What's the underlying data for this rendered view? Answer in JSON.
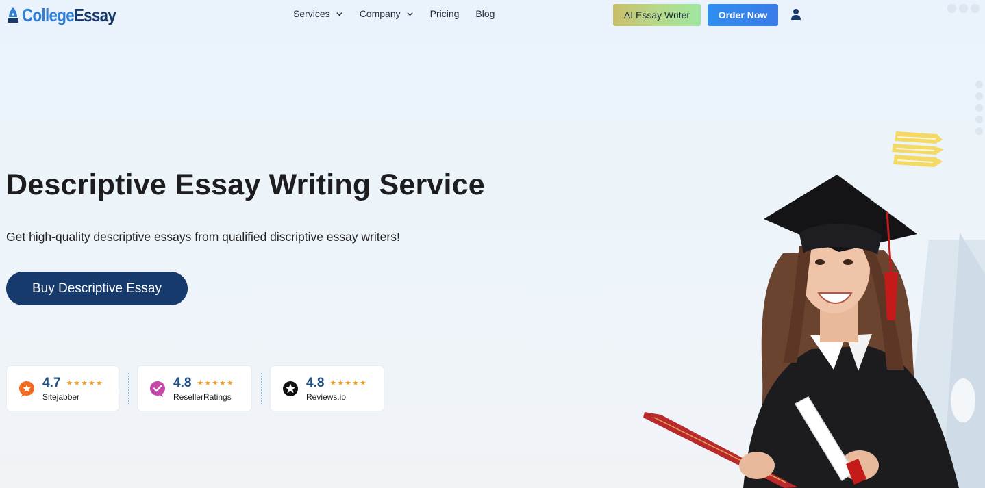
{
  "brand": {
    "part1": "College",
    "part2": "Essay"
  },
  "nav": {
    "services": "Services",
    "company": "Company",
    "pricing": "Pricing",
    "blog": "Blog"
  },
  "actions": {
    "ai_writer": "AI Essay Writer",
    "order_now": "Order Now"
  },
  "hero": {
    "title": "Descriptive Essay Writing Service",
    "subtitle": "Get high-quality descriptive essays from qualified discriptive essay writers!",
    "cta": "Buy Descriptive Essay"
  },
  "ratings": [
    {
      "score": "4.7",
      "stars": "★★★★★",
      "name": "Sitejabber",
      "icon": "sitejabber-icon"
    },
    {
      "score": "4.8",
      "stars": "★★★★★",
      "name": "ResellerRatings",
      "icon": "resellerratings-icon"
    },
    {
      "score": "4.8",
      "stars": "★★★★★",
      "name": "Reviews.io",
      "icon": "reviews-io-icon"
    }
  ],
  "colors": {
    "brand_light": "#2f80d6",
    "brand_dark": "#163a6b",
    "order_button": "#2f8ff0",
    "star": "#f0a024"
  }
}
